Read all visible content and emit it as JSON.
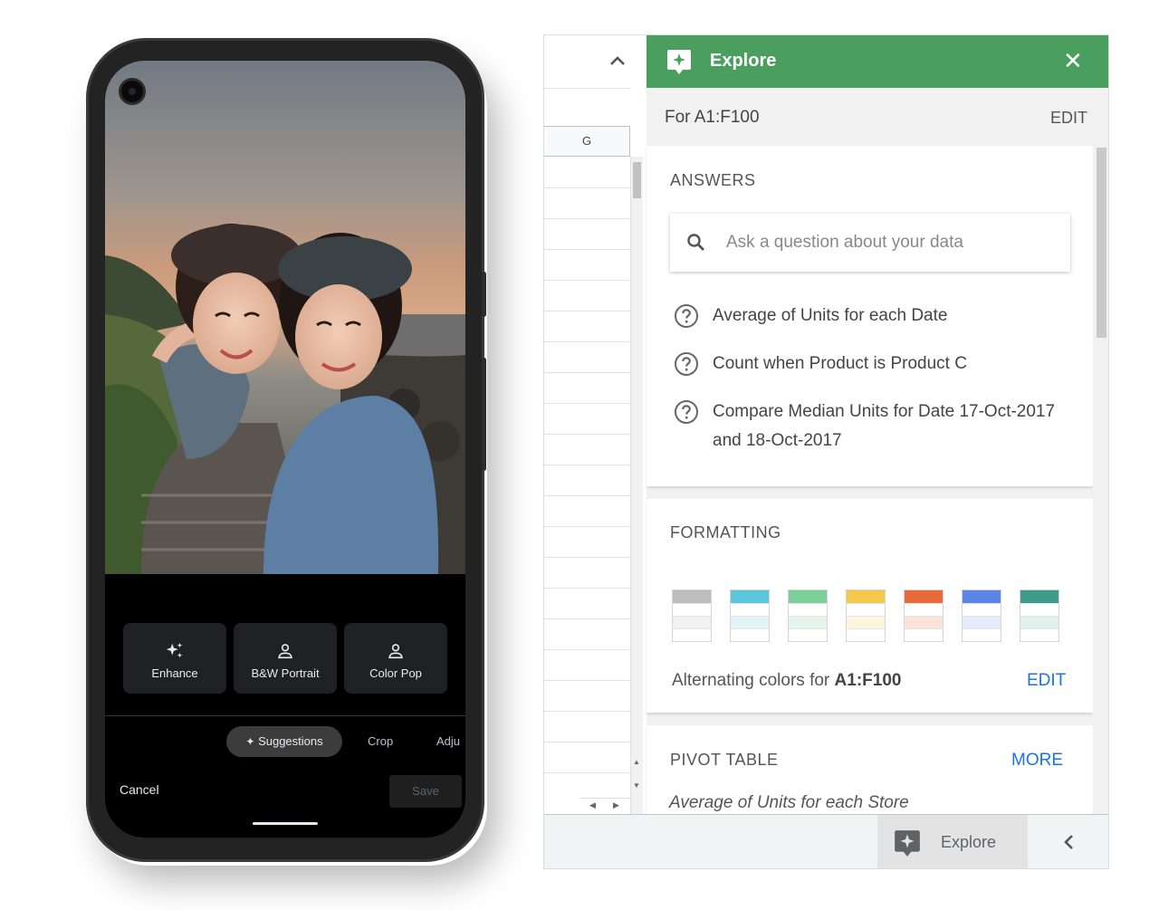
{
  "photo_editor": {
    "tools": [
      {
        "label": "Enhance",
        "icon": "sparkle-icon"
      },
      {
        "label": "B&W Portrait",
        "icon": "person-icon"
      },
      {
        "label": "Color Pop",
        "icon": "person-icon"
      }
    ],
    "tabs": {
      "suggestions": "Suggestions",
      "crop": "Crop",
      "adjust": "Adju"
    },
    "cancel_label": "Cancel",
    "save_label": "Save"
  },
  "sheets": {
    "column_header": "G",
    "explore_tab_label": "Explore",
    "explore_panel": {
      "title": "Explore",
      "range_label": "For A1:F100",
      "range_edit": "EDIT",
      "answers": {
        "title": "ANSWERS",
        "search_placeholder": "Ask a question about your data",
        "suggestions": [
          "Average of Units for each Date",
          "Count when Product is Product C",
          "Compare Median Units for Date 17-Oct-2017 and 18-Oct-2017"
        ]
      },
      "formatting": {
        "title": "FORMATTING",
        "swatch_colors": [
          "#bdbdbd",
          "#5bc5dc",
          "#7ccf98",
          "#f4c84a",
          "#e8693a",
          "#5b86e5",
          "#3e9b8c"
        ],
        "swatch_tints": [
          "#f1f1f1",
          "#e2f4f8",
          "#e6f5ec",
          "#fdf5de",
          "#fbe3da",
          "#e5ecfb",
          "#e1f0ee"
        ],
        "alt_text_prefix": "Alternating colors for ",
        "alt_text_range": "A1:F100",
        "alt_edit": "EDIT"
      },
      "pivot_table": {
        "title": "PIVOT TABLE",
        "more": "MORE",
        "subtitle": "Average of Units for each Store"
      }
    }
  }
}
